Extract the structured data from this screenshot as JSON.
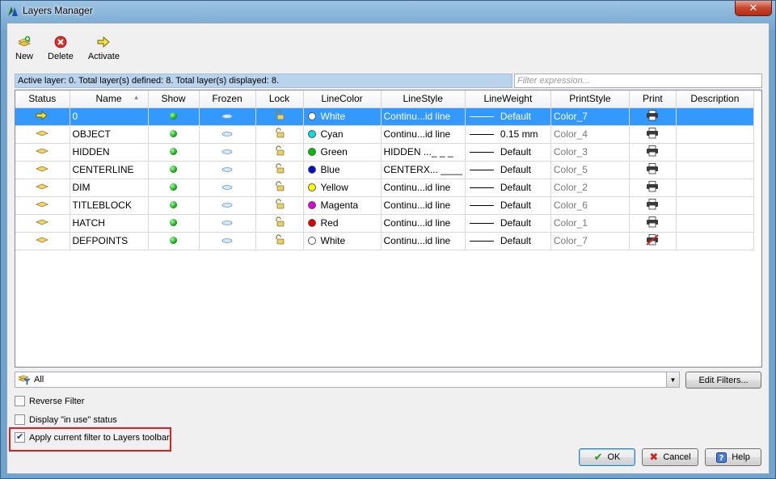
{
  "window": {
    "title": "Layers Manager",
    "close_label": "✕"
  },
  "toolbar": [
    {
      "label": "New",
      "icon": "new-layer-icon"
    },
    {
      "label": "Delete",
      "icon": "delete-icon"
    },
    {
      "label": "Activate",
      "icon": "activate-arrow-icon"
    }
  ],
  "status": {
    "text": "Active layer: 0. Total layer(s) defined: 8. Total layer(s) displayed: 8.",
    "filter_placeholder": "Filter expression..."
  },
  "columns": [
    "Status",
    "Name",
    "Show",
    "Frozen",
    "Lock",
    "LineColor",
    "LineStyle",
    "LineWeight",
    "PrintStyle",
    "Print",
    "Description"
  ],
  "layers": [
    {
      "name": "0",
      "color": "White",
      "color_hex": "#ffffff",
      "linestyle": "Continu...id line",
      "lineweight": "Default",
      "printstyle": "Color_7",
      "current": true,
      "print": true
    },
    {
      "name": "OBJECT",
      "color": "Cyan",
      "color_hex": "#00e0e0",
      "linestyle": "Continu...id line",
      "lineweight": "0.15 mm",
      "printstyle": "Color_4",
      "current": false,
      "print": true
    },
    {
      "name": "HIDDEN",
      "color": "Green",
      "color_hex": "#00c000",
      "linestyle": "HIDDEN ..._ _ _",
      "lineweight": "Default",
      "printstyle": "Color_3",
      "current": false,
      "print": true
    },
    {
      "name": "CENTERLINE",
      "color": "Blue",
      "color_hex": "#0010c0",
      "linestyle": "CENTERX... ____",
      "lineweight": "Default",
      "printstyle": "Color_5",
      "current": false,
      "print": true
    },
    {
      "name": "DIM",
      "color": "Yellow",
      "color_hex": "#ffff00",
      "linestyle": "Continu...id line",
      "lineweight": "Default",
      "printstyle": "Color_2",
      "current": false,
      "print": true
    },
    {
      "name": "TITLEBLOCK",
      "color": "Magenta",
      "color_hex": "#e000e0",
      "linestyle": "Continu...id line",
      "lineweight": "Default",
      "printstyle": "Color_6",
      "current": false,
      "print": true
    },
    {
      "name": "HATCH",
      "color": "Red",
      "color_hex": "#e00000",
      "linestyle": "Continu...id line",
      "lineweight": "Default",
      "printstyle": "Color_1",
      "current": false,
      "print": true
    },
    {
      "name": "DEFPOINTS",
      "color": "White",
      "color_hex": "#ffffff",
      "linestyle": "Continu...id line",
      "lineweight": "Default",
      "printstyle": "Color_7",
      "current": false,
      "print": false
    }
  ],
  "filter": {
    "selected": "All",
    "edit_label": "Edit Filters..."
  },
  "options": {
    "reverse_filter": {
      "label": "Reverse Filter",
      "checked": false
    },
    "in_use": {
      "label": "Display \"in use\" status",
      "checked": false
    },
    "apply_toolbar": {
      "label": "Apply current filter to Layers toolbar",
      "checked": true
    }
  },
  "buttons": {
    "ok": "OK",
    "cancel": "Cancel",
    "help": "Help"
  },
  "colors": {
    "selection": "#3399ff",
    "status_bar": "#b9d3ec",
    "highlight_border": "#e02020"
  }
}
